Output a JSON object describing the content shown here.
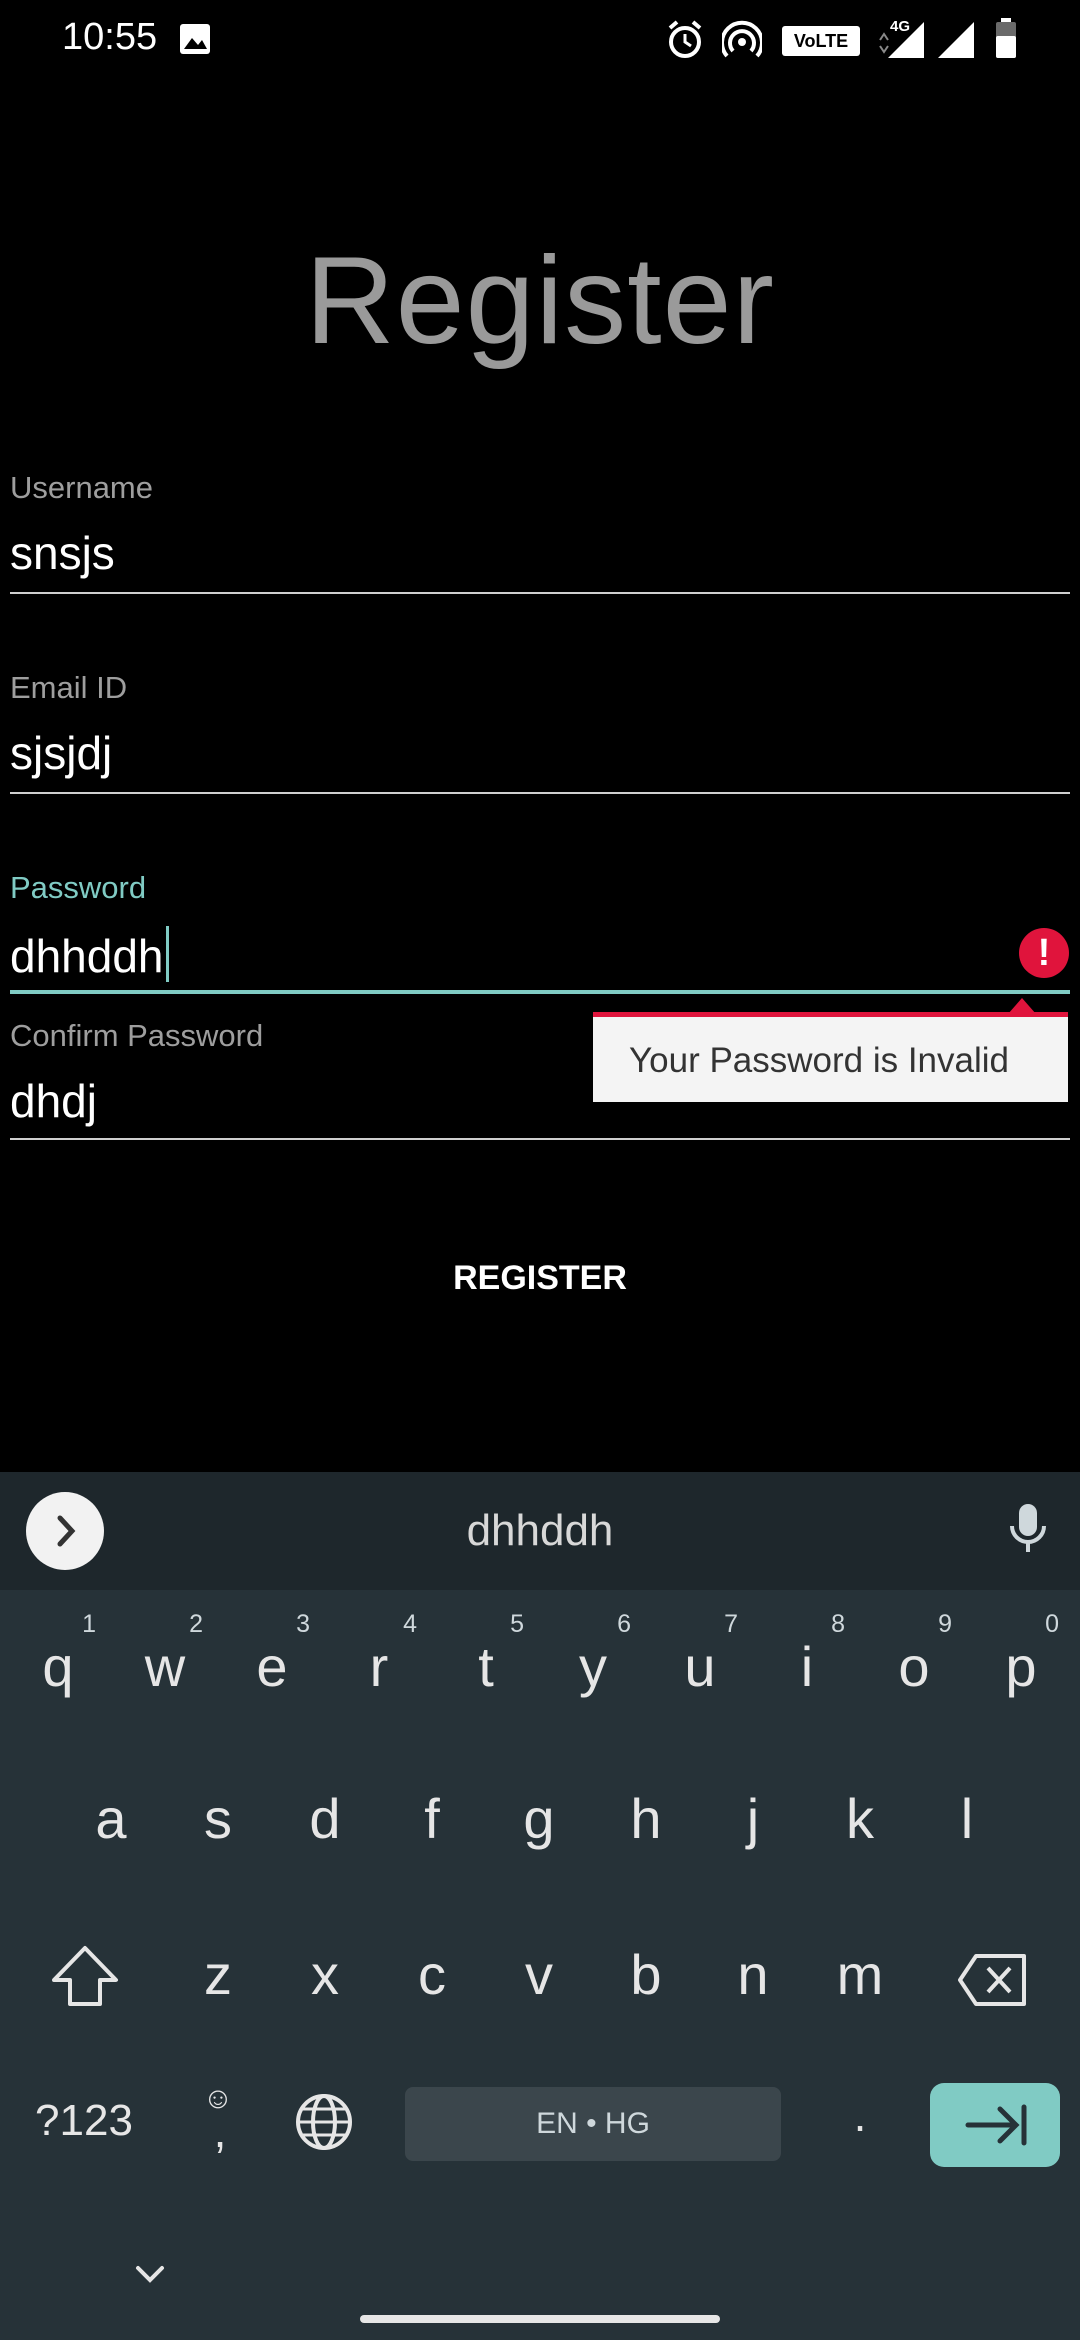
{
  "status_bar": {
    "time": "10:55",
    "icons": [
      "image-icon",
      "alarm-icon",
      "hotspot-icon",
      "volte-icon",
      "signal-4g-icon",
      "signal-icon",
      "battery-icon"
    ],
    "volte_label": "VoLTE",
    "network_label": "4G"
  },
  "title": "Register",
  "form": {
    "username": {
      "label": "Username",
      "value": "snsjs"
    },
    "email": {
      "label": "Email ID",
      "value": "sjsjdj"
    },
    "password": {
      "label": "Password",
      "value": "dhhddh",
      "error": "Your Password is Invalid"
    },
    "confirm_password": {
      "label": "Confirm Password",
      "value": "dhdj"
    },
    "register_label": "REGISTER"
  },
  "colors": {
    "accent": "#80cbc4",
    "error": "#e0143c",
    "keyboard_bg": "#263238"
  },
  "keyboard": {
    "suggestion": "dhhddh",
    "row1": [
      {
        "key": "q",
        "hint": "1"
      },
      {
        "key": "w",
        "hint": "2"
      },
      {
        "key": "e",
        "hint": "3"
      },
      {
        "key": "r",
        "hint": "4"
      },
      {
        "key": "t",
        "hint": "5"
      },
      {
        "key": "y",
        "hint": "6"
      },
      {
        "key": "u",
        "hint": "7"
      },
      {
        "key": "i",
        "hint": "8"
      },
      {
        "key": "o",
        "hint": "9"
      },
      {
        "key": "p",
        "hint": "0"
      }
    ],
    "row2": [
      "a",
      "s",
      "d",
      "f",
      "g",
      "h",
      "j",
      "k",
      "l"
    ],
    "row3": [
      "z",
      "x",
      "c",
      "v",
      "b",
      "n",
      "m"
    ],
    "symbols_label": "?123",
    "comma_label": ",",
    "space_label": "EN • HG",
    "period_label": "."
  }
}
